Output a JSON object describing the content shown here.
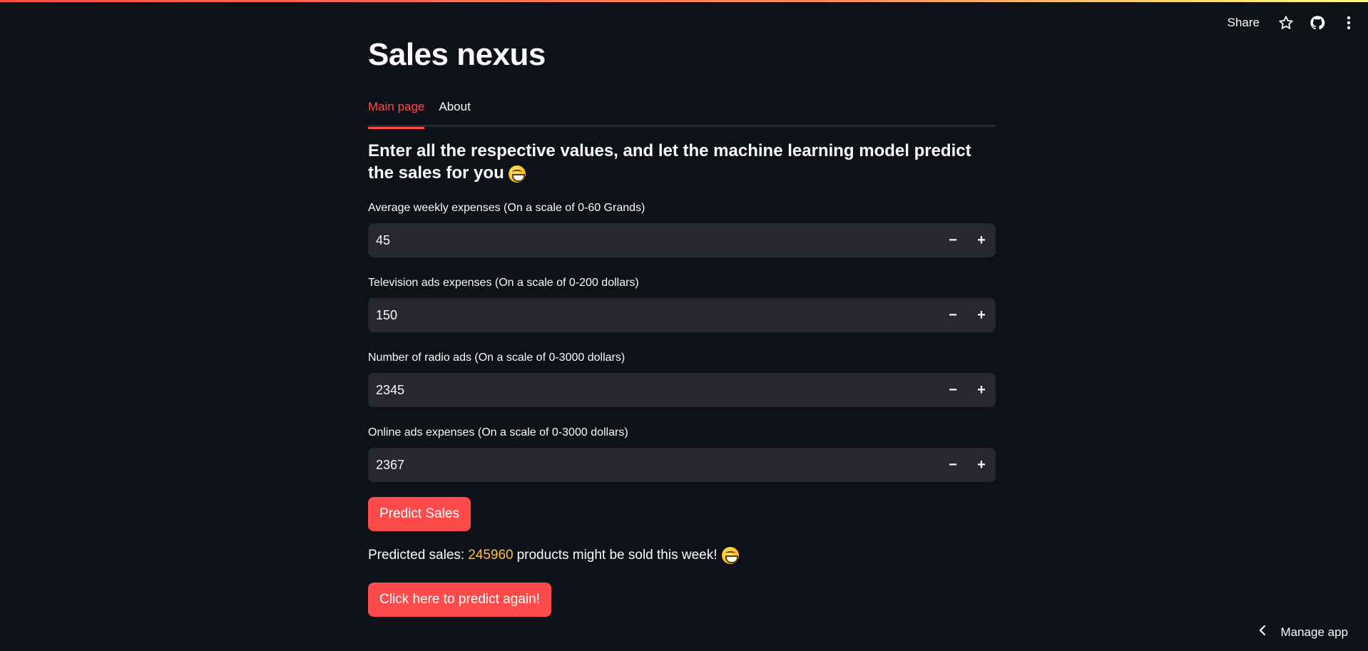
{
  "toolbar": {
    "share_label": "Share",
    "icons": [
      "star-icon",
      "github-icon",
      "more-vertical-icon"
    ]
  },
  "app": {
    "title": "Sales nexus"
  },
  "tabs": [
    {
      "label": "Main page",
      "active": true
    },
    {
      "label": "About",
      "active": false
    }
  ],
  "subheader": "Enter all the respective values, and let the machine learning model predict the sales for you",
  "fields": [
    {
      "label": "Average weekly expenses (On a scale of 0-60 Grands)",
      "value": "45"
    },
    {
      "label": "Television ads expenses (On a scale of 0-200 dollars)",
      "value": "150"
    },
    {
      "label": "Number of radio ads (On a scale of 0-3000 dollars)",
      "value": "2345"
    },
    {
      "label": "Online ads expenses (On a scale of 0-3000 dollars)",
      "value": "2367"
    }
  ],
  "stepper": {
    "minus": "−",
    "plus": "+"
  },
  "predict_button": "Predict Sales",
  "result": {
    "prefix": "Predicted sales:",
    "value": "245960",
    "suffix": "products might be sold this week!"
  },
  "again_button": "Click here to predict again!",
  "manage_app": "Manage app",
  "colors": {
    "background": "#0e1117",
    "input_bg": "#262730",
    "accent": "#ff4b4b",
    "result_number": "#ffbd45"
  }
}
